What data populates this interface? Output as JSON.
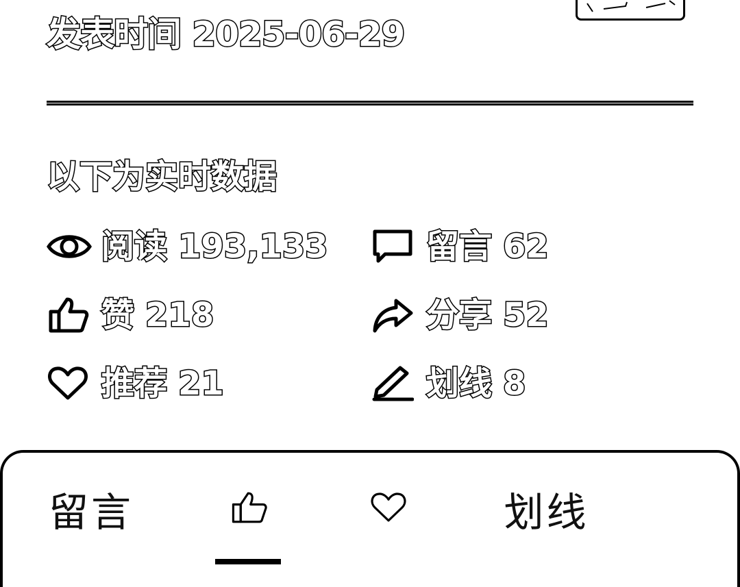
{
  "header": {
    "publish_label": "发表时间",
    "publish_date": "2025-06-29"
  },
  "stats": {
    "title": "以下为实时数据",
    "items": [
      {
        "icon": "eye-icon",
        "label": "阅读",
        "value": "193,133"
      },
      {
        "icon": "comment-icon",
        "label": "留言",
        "value": "62"
      },
      {
        "icon": "thumbs-up-icon",
        "label": "赞",
        "value": "218"
      },
      {
        "icon": "share-icon",
        "label": "分享",
        "value": "52"
      },
      {
        "icon": "heart-icon",
        "label": "推荐",
        "value": "21"
      },
      {
        "icon": "pen-icon",
        "label": "划线",
        "value": "8"
      }
    ]
  },
  "tabs": {
    "items": [
      {
        "label": "留言"
      },
      {
        "icon": "thumbs-up-icon",
        "label": ""
      },
      {
        "icon": "heart-icon",
        "label": ""
      },
      {
        "label": "划线"
      }
    ],
    "active_index": 1
  }
}
